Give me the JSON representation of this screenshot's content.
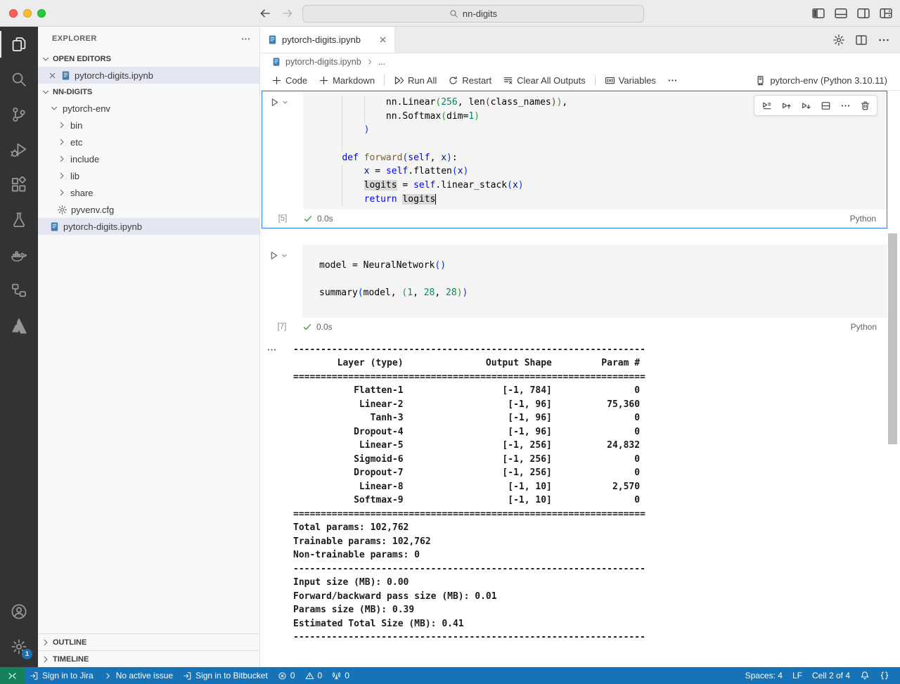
{
  "colors": {
    "status_bar_blue": "#1673b8",
    "remote_green": "#16825d",
    "focused_cell_border": "#2b7de9",
    "notebook_icon_blue": "#3e7fb0",
    "selection_bg": "#e4e6f1"
  },
  "titlebar": {
    "traffic_lights": [
      "close",
      "minimize",
      "zoom"
    ],
    "search": {
      "icon": "search-icon",
      "text": "nn-digits"
    },
    "layout_controls": [
      "toggle-sidebar-icon",
      "toggle-panel-icon",
      "toggle-secondary-sidebar-icon",
      "customize-layout-icon"
    ]
  },
  "activity_bar": {
    "top": [
      "explorer",
      "search",
      "source-control",
      "run-and-debug",
      "extensions",
      "testing",
      "docker",
      "hierarchy",
      "atlassian"
    ],
    "active": "explorer",
    "bottom": [
      "accounts",
      "settings"
    ],
    "settings_badge": "1"
  },
  "sidebar": {
    "title": "EXPLORER",
    "open_editors": {
      "header": "OPEN EDITORS",
      "items": [
        {
          "label": "pytorch-digits.ipynb",
          "icon": "notebook-icon",
          "selected": true
        }
      ]
    },
    "workspace": {
      "header": "NN-DIGITS",
      "items": [
        {
          "label": "pytorch-env",
          "twisty": "chevron-down-icon",
          "indent": 1
        },
        {
          "label": "bin",
          "twisty": "chevron-right-icon",
          "indent": 2
        },
        {
          "label": "etc",
          "twisty": "chevron-right-icon",
          "indent": 2
        },
        {
          "label": "include",
          "twisty": "chevron-right-icon",
          "indent": 2
        },
        {
          "label": "lib",
          "twisty": "chevron-right-icon",
          "indent": 2
        },
        {
          "label": "share",
          "twisty": "chevron-right-icon",
          "indent": 2
        },
        {
          "label": "pyvenv.cfg",
          "icon": "gear-icon",
          "indent": 2
        },
        {
          "label": "pytorch-digits.ipynb",
          "icon": "notebook-icon",
          "indent": 1,
          "selected": true
        }
      ]
    },
    "outline_header": "OUTLINE",
    "timeline_header": "TIMELINE"
  },
  "editor": {
    "tab": {
      "label": "pytorch-digits.ipynb"
    },
    "actions": [
      "gear-icon",
      "split-editor-icon",
      "ellipsis-icon"
    ],
    "breadcrumb": {
      "file": "pytorch-digits.ipynb",
      "more": "..."
    }
  },
  "notebook_toolbar": {
    "buttons": [
      {
        "name": "add-code-button",
        "icon": "add-icon",
        "label": "Code"
      },
      {
        "name": "add-markdown-button",
        "icon": "add-icon",
        "label": "Markdown"
      },
      {
        "type": "divider"
      },
      {
        "name": "run-all-button",
        "icon": "run-all-icon",
        "label": "Run All"
      },
      {
        "name": "restart-button",
        "icon": "restart-icon",
        "label": "Restart"
      },
      {
        "name": "clear-all-outputs-button",
        "icon": "clear-outputs-icon",
        "label": "Clear All Outputs"
      },
      {
        "type": "divider"
      },
      {
        "name": "variables-button",
        "icon": "variables-icon",
        "label": "Variables"
      },
      {
        "name": "more-toolbar-actions-button",
        "icon": "ellipsis-icon",
        "label": ""
      }
    ],
    "kernel": {
      "icon": "kernel-icon",
      "label": "pytorch-env (Python 3.10.11)"
    }
  },
  "cell_toolbar": [
    "run-by-line-icon",
    "execute-above-icon",
    "execute-below-icon",
    "split-cell-icon",
    "more-actions-icon",
    "delete-cell-icon"
  ],
  "cells": {
    "cell1": {
      "exec_label": "[5]",
      "duration": "0.0s",
      "language": "Python",
      "lines": [
        {
          "g": [
            4,
            8
          ],
          "t": [
            [
              "d",
              "            nn.Linear"
            ],
            [
              "b2",
              "("
            ],
            [
              "n",
              "256"
            ],
            [
              "d",
              ", len"
            ],
            [
              "b3",
              "("
            ],
            [
              "d",
              "class_names"
            ],
            [
              "b3",
              ")"
            ],
            [
              "b2",
              ")"
            ],
            [
              "d",
              ","
            ]
          ]
        },
        {
          "g": [
            4,
            8
          ],
          "t": [
            [
              "d",
              "            nn.Softmax"
            ],
            [
              "b2",
              "("
            ],
            [
              "d",
              "dim="
            ],
            [
              "n",
              "1"
            ],
            [
              "b2",
              ")"
            ]
          ]
        },
        {
          "g": [
            4
          ],
          "t": [
            [
              "d",
              "        "
            ],
            [
              "b1",
              ")"
            ]
          ]
        },
        {
          "g": [
            4
          ],
          "t": []
        },
        {
          "g": [],
          "t": [
            [
              "d",
              "    "
            ],
            [
              "k",
              "def "
            ],
            [
              "f",
              "forward"
            ],
            [
              "b1",
              "("
            ],
            [
              "s",
              "self"
            ],
            [
              "d",
              ", "
            ],
            [
              "v",
              "x"
            ],
            [
              "b1",
              ")"
            ],
            [
              "d",
              ":"
            ]
          ]
        },
        {
          "g": [
            4
          ],
          "t": [
            [
              "d",
              "        "
            ],
            [
              "v",
              "x"
            ],
            [
              "d",
              " = "
            ],
            [
              "s",
              "self"
            ],
            [
              "d",
              ".flatten"
            ],
            [
              "b1",
              "("
            ],
            [
              "v",
              "x"
            ],
            [
              "b1",
              ")"
            ]
          ]
        },
        {
          "g": [
            4
          ],
          "t": [
            [
              "d",
              "        "
            ],
            [
              "hl",
              "logits"
            ],
            [
              "d",
              " = "
            ],
            [
              "s",
              "self"
            ],
            [
              "d",
              ".linear_stack"
            ],
            [
              "b1",
              "("
            ],
            [
              "v",
              "x"
            ],
            [
              "b1",
              ")"
            ]
          ]
        },
        {
          "g": [
            4
          ],
          "t": [
            [
              "d",
              "        "
            ],
            [
              "k",
              "return "
            ],
            [
              "hlc",
              "logits"
            ]
          ]
        }
      ]
    },
    "cell2": {
      "exec_label": "[7]",
      "duration": "0.0s",
      "language": "Python",
      "lines": [
        {
          "g": [],
          "t": [
            [
              "d",
              "model = NeuralNetwork"
            ],
            [
              "b1",
              "()"
            ]
          ]
        },
        {
          "g": [],
          "t": []
        },
        {
          "g": [],
          "t": [
            [
              "d",
              "summary"
            ],
            [
              "b1",
              "("
            ],
            [
              "d",
              "model, "
            ],
            [
              "b2",
              "("
            ],
            [
              "n",
              "1"
            ],
            [
              "d",
              ", "
            ],
            [
              "n",
              "28"
            ],
            [
              "d",
              ", "
            ],
            [
              "n",
              "28"
            ],
            [
              "b2",
              ")"
            ],
            [
              "b1",
              ")"
            ]
          ]
        }
      ]
    }
  },
  "output": {
    "lines": [
      "----------------------------------------------------------------",
      "        Layer (type)               Output Shape         Param #",
      "================================================================",
      "           Flatten-1                  [-1, 784]               0",
      "            Linear-2                   [-1, 96]          75,360",
      "              Tanh-3                   [-1, 96]               0",
      "           Dropout-4                   [-1, 96]               0",
      "            Linear-5                  [-1, 256]          24,832",
      "           Sigmoid-6                  [-1, 256]               0",
      "           Dropout-7                  [-1, 256]               0",
      "            Linear-8                   [-1, 10]           2,570",
      "           Softmax-9                   [-1, 10]               0",
      "================================================================",
      "Total params: 102,762",
      "Trainable params: 102,762",
      "Non-trainable params: 0",
      "----------------------------------------------------------------",
      "Input size (MB): 0.00",
      "Forward/backward pass size (MB): 0.01",
      "Params size (MB): 0.39",
      "Estimated Total Size (MB): 0.41",
      "----------------------------------------------------------------"
    ]
  },
  "status_bar": {
    "left": [
      {
        "name": "remote-indicator",
        "icon": "remote-icon",
        "text": ""
      },
      {
        "name": "jira-sign-in",
        "icon": "signin-icon",
        "text": "Sign in to Jira"
      },
      {
        "name": "active-issue",
        "icon": "chevron-right-icon",
        "text": "No active issue"
      },
      {
        "name": "bitbucket-sign-in",
        "icon": "signin-icon",
        "text": "Sign in to Bitbucket"
      },
      {
        "name": "errors",
        "icon": "error-icon",
        "text": "0"
      },
      {
        "name": "warnings",
        "icon": "warning-icon",
        "text": "0"
      },
      {
        "name": "ports",
        "icon": "ports-icon",
        "text": "0"
      }
    ],
    "right": [
      {
        "name": "indentation",
        "text": "Spaces: 4"
      },
      {
        "name": "eol",
        "text": "LF"
      },
      {
        "name": "cell-position",
        "text": "Cell 2 of 4"
      },
      {
        "name": "notifications",
        "icon": "bell-icon",
        "text": ""
      },
      {
        "name": "braces",
        "icon": "braces-icon",
        "text": ""
      }
    ]
  }
}
